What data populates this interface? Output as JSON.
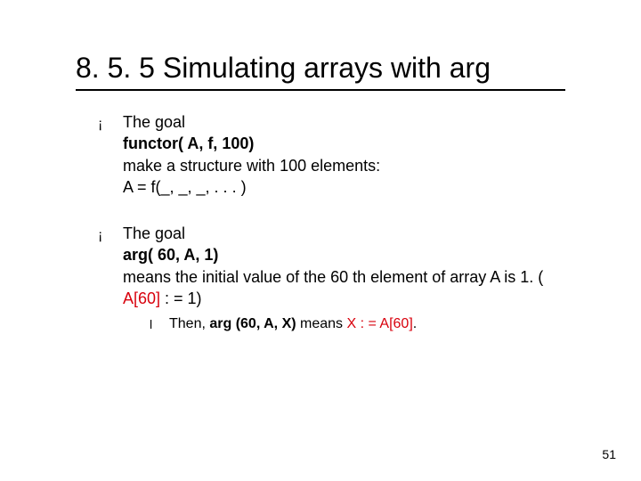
{
  "title": "8. 5. 5 Simulating arrays with arg",
  "items": [
    {
      "lines": [
        {
          "segs": [
            {
              "t": "The goal"
            }
          ]
        },
        {
          "segs": [
            {
              "t": "functor( A, f, 100)",
              "bold": true
            }
          ]
        },
        {
          "segs": [
            {
              "t": "make a structure with 100 elements:"
            }
          ]
        },
        {
          "segs": [
            {
              "t": "A = f(_, _, _, . . . )"
            }
          ]
        }
      ]
    },
    {
      "lines": [
        {
          "segs": [
            {
              "t": "The goal"
            }
          ]
        },
        {
          "segs": [
            {
              "t": "arg( 60, A, 1)",
              "bold": true
            }
          ]
        },
        {
          "segs": [
            {
              "t": "means the initial value of the 60 th element of array A is 1. ( "
            },
            {
              "t": "A[60]",
              "red": true
            },
            {
              "t": " : = 1)"
            }
          ]
        }
      ],
      "sub": {
        "segs": [
          {
            "t": "Then, "
          },
          {
            "t": "arg (60, A, X) ",
            "bold": true
          },
          {
            "t": " means "
          },
          {
            "t": "X : = A[60]",
            "red": true
          },
          {
            "t": "."
          }
        ]
      }
    }
  ],
  "page_number": "51",
  "bullets": {
    "hollow": "¡",
    "solid": "l"
  }
}
